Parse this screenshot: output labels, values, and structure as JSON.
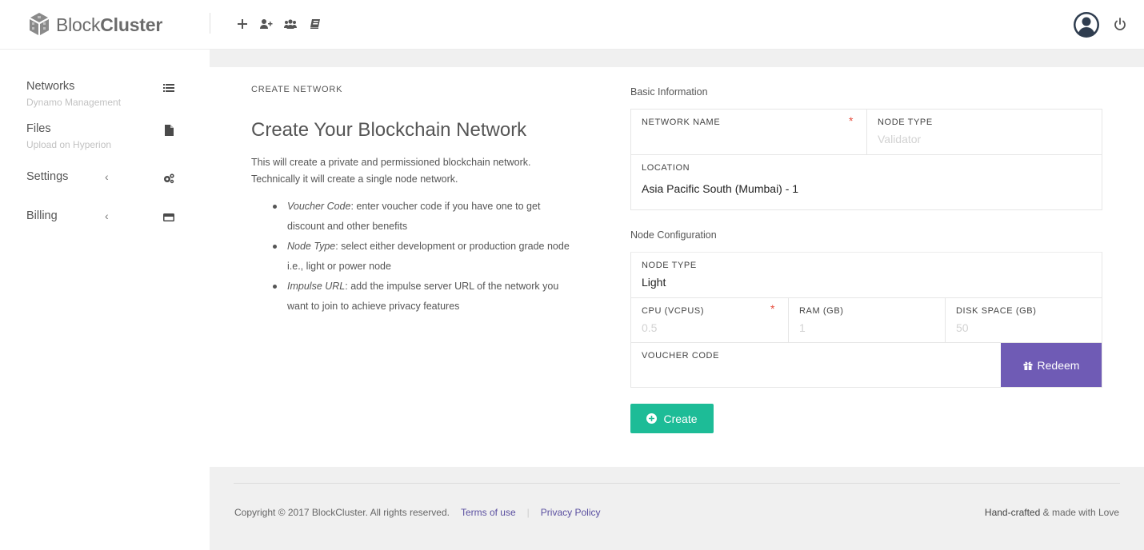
{
  "brand": {
    "name_light": "Block",
    "name_bold": "Cluster"
  },
  "toolbar": {
    "icons": [
      "plus-icon",
      "add-user-icon",
      "users-icon",
      "book-icon"
    ]
  },
  "sidebar": {
    "items": [
      {
        "label": "Networks",
        "sublabel": "Dynamo Management",
        "icon": "list-icon"
      },
      {
        "label": "Files",
        "sublabel": "Upload on Hyperion",
        "icon": "file-icon"
      },
      {
        "label": "Settings",
        "chevron": "‹",
        "icon": "cogs-icon"
      },
      {
        "label": "Billing",
        "chevron": "‹",
        "icon": "credit-card-icon"
      }
    ]
  },
  "main": {
    "block_title": "CREATE NETWORK",
    "heading": "Create Your Blockchain Network",
    "intro": "This will create a private and permissioned blockchain network. Technically it will create a single node network.",
    "bullets": [
      {
        "term": "Voucher Code",
        "text": ": enter voucher code if you have one to get discount and other benefits"
      },
      {
        "term": "Node Type",
        "text": ": select either development or production grade node i.e., light or power node"
      },
      {
        "term": "Impulse URL",
        "text": ": add the impulse server URL of the network you want to join to achieve privacy features"
      }
    ]
  },
  "form": {
    "basic_title": "Basic Information",
    "network_name_label": "NETWORK NAME",
    "network_name_value": "",
    "node_type_label": "NODE TYPE",
    "node_type_placeholder": "Validator",
    "location_label": "LOCATION",
    "location_value": "Asia Pacific South (Mumbai) - 1",
    "node_config_title": "Node Configuration",
    "config_node_type_label": "NODE TYPE",
    "config_node_type_value": "Light",
    "cpu_label": "CPU (VCPUS)",
    "cpu_placeholder": "0.5",
    "ram_label": "RAM (GB)",
    "ram_placeholder": "1",
    "disk_label": "DISK SPACE (GB)",
    "disk_placeholder": "50",
    "voucher_label": "VOUCHER CODE",
    "voucher_value": "",
    "required_mark": "*",
    "redeem_label": "Redeem",
    "create_label": "Create"
  },
  "footer": {
    "copyright": "Copyright © 2017 BlockCluster. All rights reserved.",
    "terms": "Terms of use",
    "separator": "|",
    "privacy": "Privacy Policy",
    "handcrafted": "Hand-crafted",
    "made_with": " & made with Love"
  },
  "colors": {
    "accent_purple": "#6f5bb5",
    "accent_green": "#1dbc97",
    "required_red": "#e74c3c",
    "content_bg": "#f0f0f0"
  }
}
